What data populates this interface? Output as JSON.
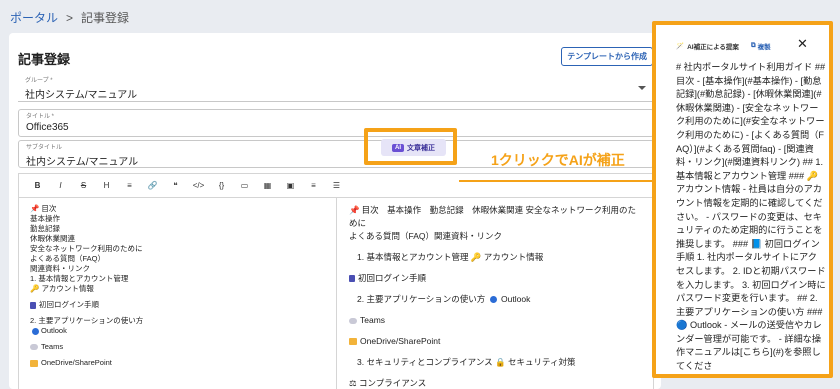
{
  "breadcrumb": {
    "root": "ポータル",
    "separator": ">",
    "current": "記事登録"
  },
  "form": {
    "title": "記事登録",
    "template_button": "テンプレートから作成",
    "group": {
      "label": "グループ *",
      "value": "社内システム/マニュアル"
    },
    "title_field": {
      "label": "タイトル *",
      "value": "Office365"
    },
    "subtitle_field": {
      "label": "サブタイトル",
      "value": "社内システム/マニュアル"
    }
  },
  "toolbar": {
    "buttons": [
      "B",
      "I",
      "S",
      "H",
      "≡",
      "🔗",
      "❝",
      "</>",
      "{}",
      "▭",
      "▦",
      "▣",
      "≡",
      "☰"
    ],
    "ai_button": {
      "tag": "AI",
      "label": "文章補正"
    }
  },
  "editor": {
    "left_lines": [
      "目次",
      "基本操作",
      "勤怠記録",
      "休暇休業関連",
      "安全なネットワーク利用のために",
      "よくある質問（FAQ）",
      "関連資料・リンク",
      "1. 基本情報とアカウント管理",
      "アカウント情報",
      "初回ログイン手順",
      "2. 主要アプリケーションの使い方",
      "Outlook",
      "Teams",
      "OneDrive/SharePoint"
    ],
    "right_toc": "目次　基本操作　勤怠記録　休暇休業関連 安全なネットワーク利用のために",
    "right_toc2": "よくある質問（FAQ）関連資料・リンク",
    "right_s1": "1. 基本情報とアカウント管理",
    "right_s1_item": "アカウント情報",
    "right_login": "初回ログイン手順",
    "right_s2": "2. 主要アプリケーションの使い方",
    "right_s2_item": "Outlook",
    "right_teams": "Teams",
    "right_onedrive": "OneDrive/SharePoint",
    "right_s3": "3. セキュリティとコンプライアンス",
    "right_s3_item": "セキュリティ対策",
    "right_compliance": "コンプライアンス"
  },
  "callout": "1クリックでAIが補正",
  "ai_panel": {
    "title": "AI補正による提案",
    "copy_label": "複製",
    "close_label": "✕",
    "text": "# 社内ポータルサイト利用ガイド ## 目次 - [基本操作](#基本操作) - [勤怠記録](#勤怠記録) - [休暇休業関連](#休暇休業関連) - [安全なネットワーク利用のために](#安全なネットワーク利用のために) - [よくある質問（FAQ）](#よくある質問faq) - [関連資料・リンク](#関連資料リンク) ## 1. 基本情報とアカウント管理 ### 🔑 アカウント情報 - 社員は自分のアカウント情報を定期的に確認してください。 - パスワードの変更は、セキュリティのため定期的に行うことを推奨します。 ### 📘 初回ログイン手順 1. 社内ポータルサイトにアクセスします。 2. IDと初期パスワードを入力します。 3. 初回ログイン時にパスワード変更を行います。 ## 2. 主要アプリケーションの使い方 ### 🔵 Outlook - メールの送受信やカレンダー管理が可能です。 - 詳細な操作マニュアルは[こちら](#)を参照してくださ"
  }
}
